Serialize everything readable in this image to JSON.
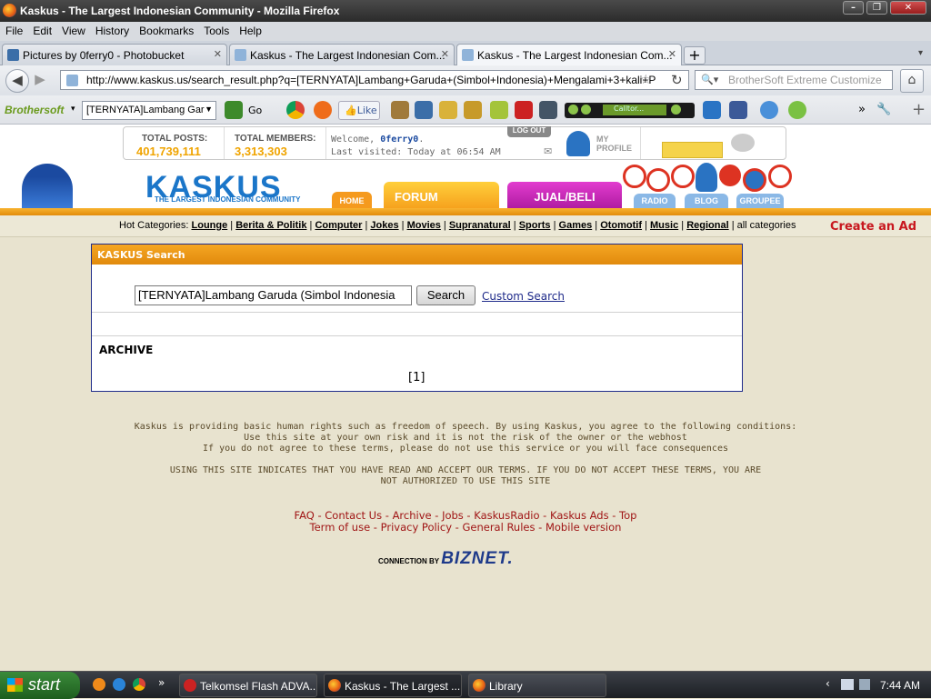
{
  "window": {
    "title": "Kaskus - The Largest Indonesian Community - Mozilla Firefox"
  },
  "menu": [
    "File",
    "Edit",
    "View",
    "History",
    "Bookmarks",
    "Tools",
    "Help"
  ],
  "tabs": [
    {
      "label": "Pictures by 0ferry0 - Photobucket",
      "active": false
    },
    {
      "label": "Kaskus - The Largest Indonesian Com...",
      "active": false
    },
    {
      "label": "Kaskus - The Largest Indonesian Com...",
      "active": true
    }
  ],
  "nav": {
    "url": "http://www.kaskus.us/search_result.php?q=[TERNYATA]Lambang+Garuda+(Simbol+Indonesia)+Mengalami+3+kali+P",
    "search_placeholder": "BrotherSoft Extreme Customize"
  },
  "toolbar": {
    "brand": "Brothersoft",
    "search_value": "[TERNYATA]Lambang Gar",
    "go_label": "Go",
    "like_label": "Like",
    "player_label": "Calltor..."
  },
  "header": {
    "total_posts_label": "TOTAL POSTS:",
    "total_posts_value": "401,739,111",
    "total_members_label": "TOTAL MEMBERS:",
    "total_members_value": "3,313,303",
    "welcome_prefix": "Welcome, ",
    "username": "0ferry0",
    "last_visited": "Last visited: Today at 06:54 AM",
    "logout": "LOG OUT",
    "my_profile": "MY PROFILE",
    "logo": "KASKUS",
    "tagline": "THE LARGEST INDONESIAN COMMUNITY",
    "nav_tabs": [
      "HOME",
      "FORUM",
      "JUAL/BELI",
      "RADIO",
      "BLOG",
      "GROUPEE"
    ]
  },
  "hot": {
    "prefix": "Hot Categories:",
    "items": [
      "Lounge",
      "Berita & Politik",
      "Computer",
      "Jokes",
      "Movies",
      "Supranatural",
      "Sports",
      "Games",
      "Otomotif",
      "Music",
      "Regional"
    ],
    "all": "all categories",
    "create_ad": "Create an Ad"
  },
  "search_panel": {
    "title": "KASKUS Search",
    "query": "[TERNYATA]Lambang Garuda (Simbol Indonesia",
    "button": "Search",
    "custom": "Custom Search",
    "archive": "ARCHIVE",
    "page": "[1]"
  },
  "footer": {
    "line1": "Kaskus is providing basic human rights such as freedom of speech. By using Kaskus, you agree to the following conditions:",
    "line2": "Use this site at your own risk and it is not the risk of the owner or the webhost",
    "line3": "If you do not agree to these terms, please do not use this service or you will face consequences",
    "line4": "USING THIS SITE INDICATES THAT YOU HAVE READ AND ACCEPT OUR TERMS. IF YOU DO NOT ACCEPT THESE TERMS, YOU ARE",
    "line5": "NOT AUTHORIZED TO USE THIS SITE",
    "links1": [
      "FAQ",
      "Contact Us",
      "Archive",
      "Jobs",
      "KaskusRadio",
      "Kaskus Ads",
      "Top"
    ],
    "links2": [
      "Term of use",
      "Privacy Policy",
      "General Rules",
      "Mobile version"
    ],
    "connection": "CONNECTION BY",
    "biznet": "BIZNET."
  },
  "taskbar": {
    "start": "start",
    "tasks": [
      {
        "label": "Telkomsel Flash ADVA...",
        "active": false
      },
      {
        "label": "Kaskus - The Largest ...",
        "active": true
      },
      {
        "label": "Library",
        "active": false
      }
    ],
    "clock": "7:44 AM"
  }
}
